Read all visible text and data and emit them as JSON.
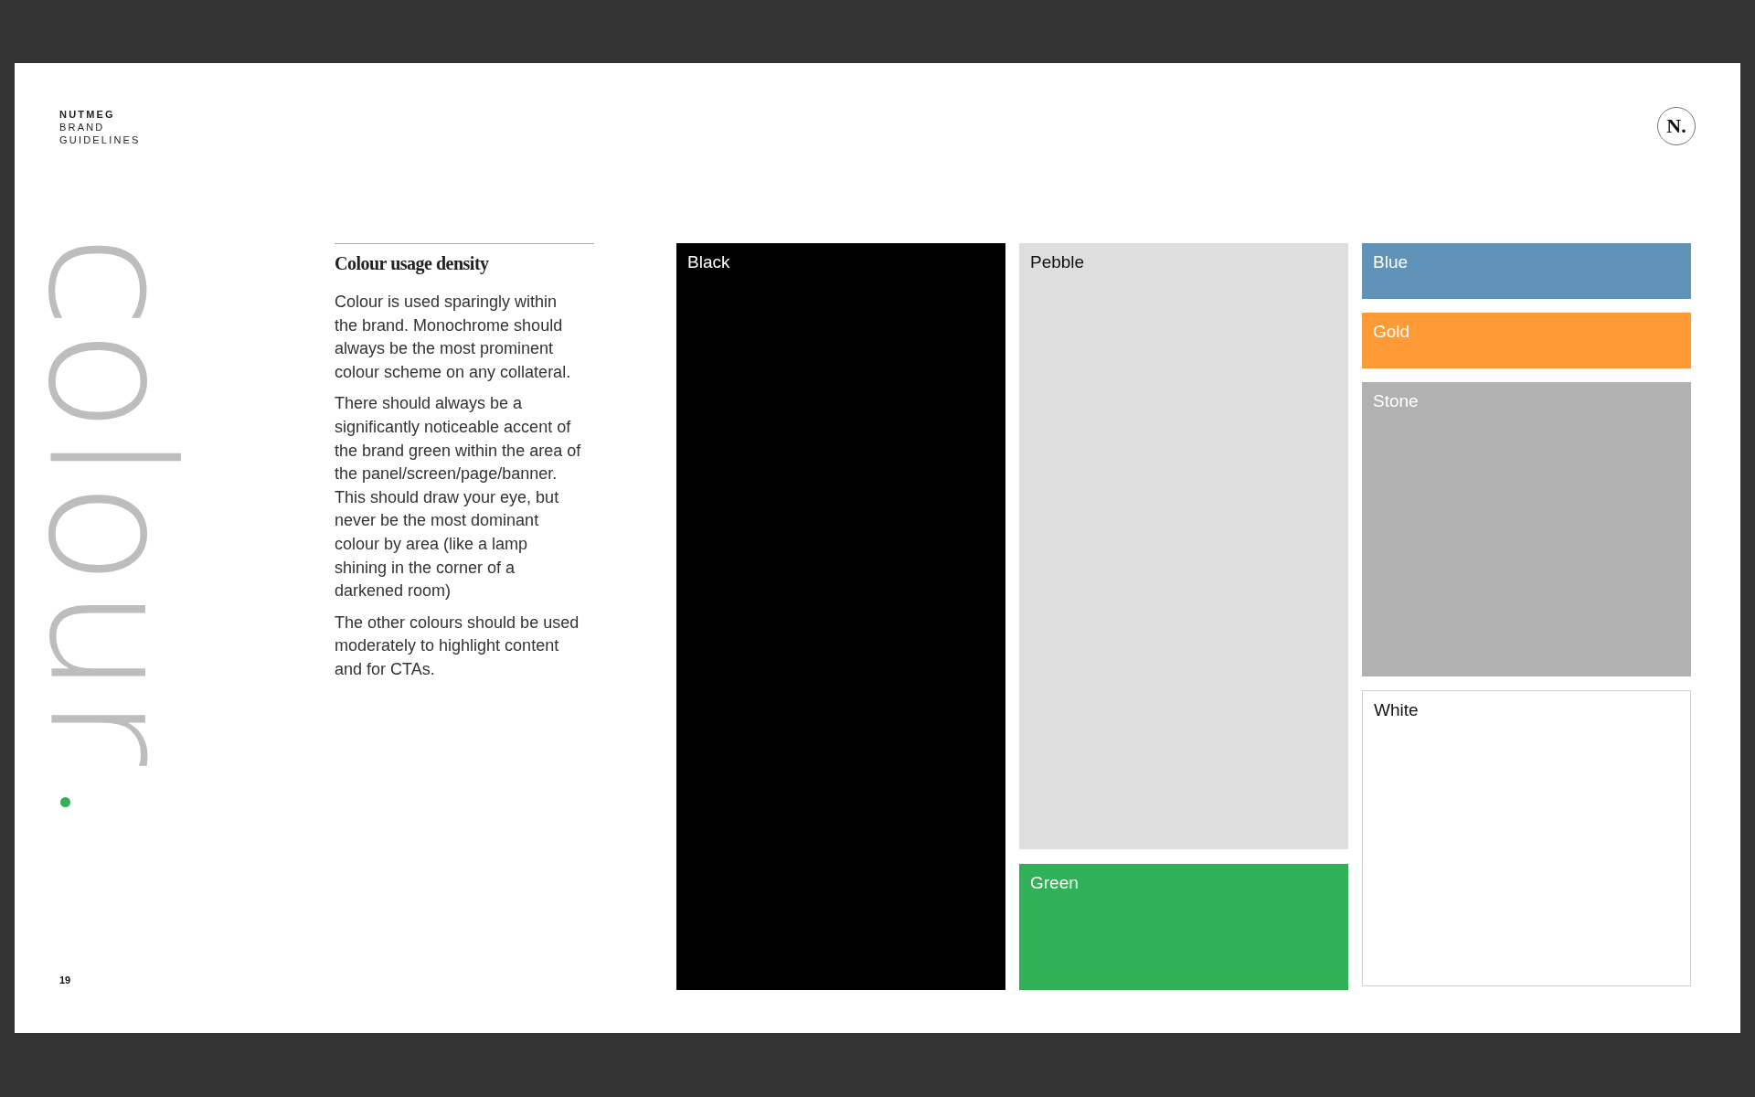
{
  "header": {
    "brand": "NUTMEG",
    "subtitle_lines": [
      "BRAND",
      "GUIDELINES"
    ],
    "logo_letter": "N."
  },
  "section_title": "colour",
  "article": {
    "heading": "Colour usage density",
    "paragraphs": [
      "Colour is used sparingly within the brand. Monochrome should always be the most prominent colour scheme on any collateral.",
      "There should always be a significantly noticeable accent of the brand green within the area of the panel/screen/page/banner. This should draw your eye, but never be the most dominant colour by area (like a lamp shining in the corner of a darkened room)",
      "The other colours should be used moderately to highlight content and for CTAs."
    ]
  },
  "swatch_columns": [
    [
      {
        "name": "Black",
        "color": "#000000",
        "light_label": true,
        "outlined": false
      }
    ],
    [
      {
        "name": "Pebble",
        "color": "#dfdede",
        "light_label": false,
        "outlined": false
      },
      {
        "name": "Green",
        "color": "#31b157",
        "light_label": true,
        "outlined": false
      }
    ],
    [
      {
        "name": "Blue",
        "color": "#6093b7",
        "light_label": true,
        "outlined": false
      },
      {
        "name": "Gold",
        "color": "#ff9b37",
        "light_label": true,
        "outlined": false
      },
      {
        "name": "Stone",
        "color": "#b1b1b1",
        "light_label": true,
        "outlined": false
      },
      {
        "name": "White",
        "color": "#ffffff",
        "light_label": false,
        "outlined": true
      }
    ]
  ],
  "page_number": "19"
}
